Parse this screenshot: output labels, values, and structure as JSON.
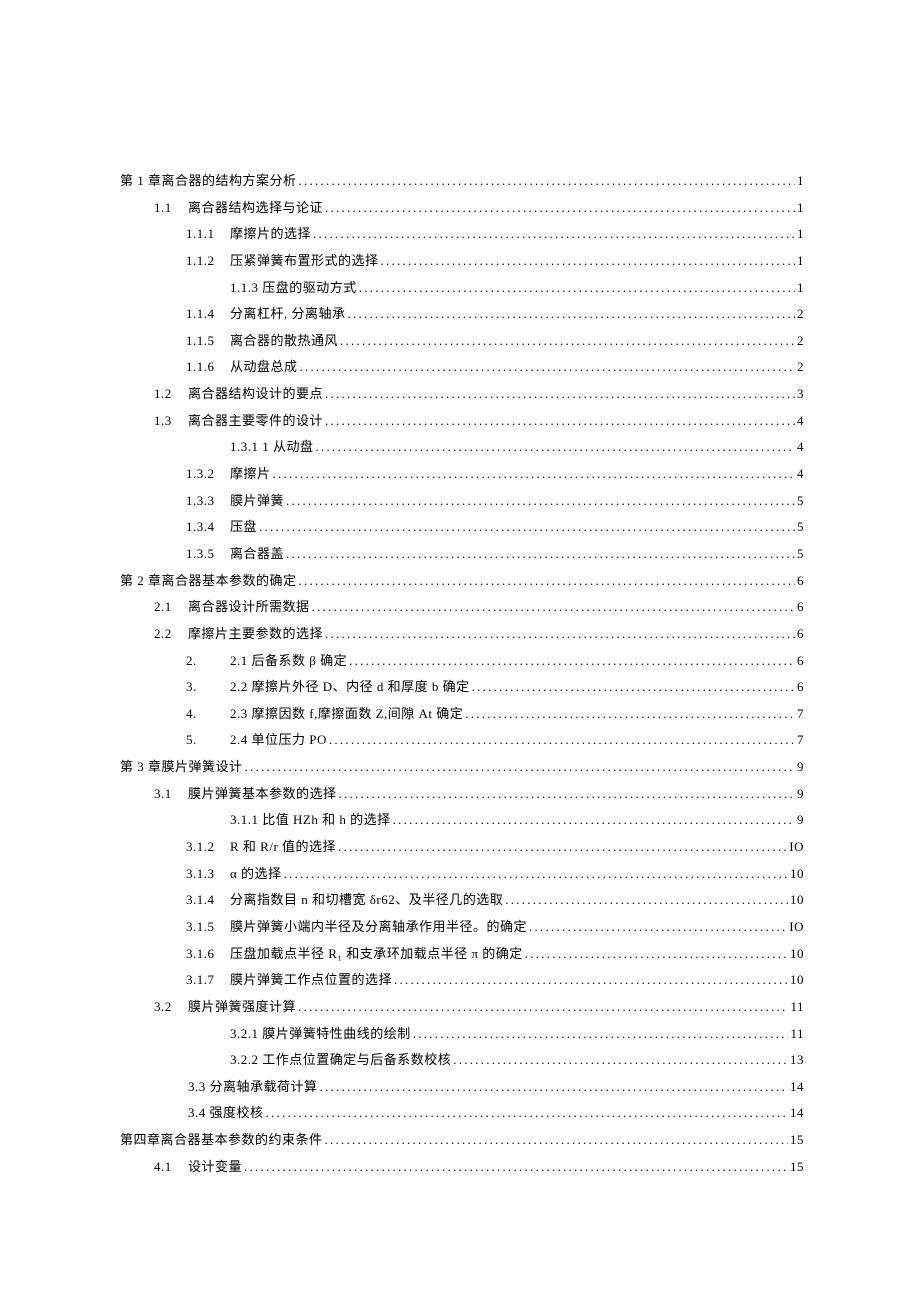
{
  "toc": [
    {
      "level": 0,
      "num": "",
      "title": "第 1 章离合器的结构方案分析",
      "page": "1"
    },
    {
      "level": 1,
      "num": "1.1",
      "title": "离合器结构选择与论证",
      "page": "1"
    },
    {
      "level": 2,
      "num": "1.1.1",
      "title": "摩擦片的选择",
      "page": "1"
    },
    {
      "level": 2,
      "num": "1.1.2",
      "title": "压紧弹簧布置形式的选择",
      "page": "1"
    },
    {
      "level": 2,
      "num": "",
      "title": "1.1.3 压盘的驱动方式",
      "page": "1"
    },
    {
      "level": 2,
      "num": "1.1.4",
      "title": "分离杠杆, 分离轴承",
      "page": "2"
    },
    {
      "level": 2,
      "num": "1.1.5",
      "title": "离合器的散热通风",
      "page": "2"
    },
    {
      "level": 2,
      "num": "1.1.6",
      "title": "从动盘总成",
      "page": "2"
    },
    {
      "level": 1,
      "num": "1.2",
      "title": "离合器结构设计的要点",
      "page": "3"
    },
    {
      "level": 1,
      "num": "1.3",
      "title": "离合器主要零件的设计",
      "page": "4"
    },
    {
      "level": 2,
      "num": "",
      "title": "1.3.1  1 从动盘",
      "page": "4"
    },
    {
      "level": 2,
      "num": "1.3.2",
      "title": "摩擦片",
      "page": "4"
    },
    {
      "level": 2,
      "num": "1.3.3",
      "title": "膜片弹簧",
      "page": "5"
    },
    {
      "level": 2,
      "num": "1.3.4",
      "title": "压盘",
      "page": "5"
    },
    {
      "level": 2,
      "num": "1.3.5",
      "title": "离合器盖",
      "page": "5"
    },
    {
      "level": 0,
      "num": "",
      "title": "第 2 章离合器基本参数的确定",
      "page": "6"
    },
    {
      "level": 1,
      "num": "2.1",
      "title": "离合器设计所需数据",
      "page": "6"
    },
    {
      "level": 1,
      "num": "2.2",
      "title": "摩擦片主要参数的选择",
      "page": "6"
    },
    {
      "level": 2,
      "num": "2.",
      "title": "2.1 后备系数 β 确定",
      "page": "6"
    },
    {
      "level": 2,
      "num": "3.",
      "title": "2.2 摩擦片外径 D、内径 d 和厚度 b 确定",
      "page": "6"
    },
    {
      "level": 2,
      "num": "4.",
      "title": "2.3 摩擦因数 f,摩擦面数 Z,间隙 At 确定",
      "page": "7"
    },
    {
      "level": 2,
      "num": "5.",
      "title": "2.4 单位压力 PO ",
      "page": "7"
    },
    {
      "level": 0,
      "num": "",
      "title": "第 3 章膜片弹簧设计",
      "page": "9"
    },
    {
      "level": 1,
      "num": "3.1",
      "title": "膜片弹簧基本参数的选择",
      "page": "9"
    },
    {
      "level": 2,
      "num": "",
      "title": "3.1.1  比值 HZh 和 h 的选择",
      "page": "9"
    },
    {
      "level": 2,
      "num": "3.1.2",
      "title": "R 和 R/r 值的选择",
      "page": "IO"
    },
    {
      "level": 2,
      "num": "3.1.3",
      "title": "α 的选择",
      "page": "10"
    },
    {
      "level": 2,
      "num": "3.1.4",
      "title": "分离指数目 n 和切槽宽 δr62、及半径几的选取",
      "page": "10"
    },
    {
      "level": 2,
      "num": "3.1.5",
      "title": "膜片弹簧小端内半径及分离轴承作用半径。的确定",
      "page": "IO"
    },
    {
      "level": 2,
      "num": "3.1.6",
      "title": "压盘加载点半径 R₁ 和支承环加载点半径 π 的确定",
      "page": "10"
    },
    {
      "level": 2,
      "num": "3.1.7",
      "title": "膜片弹簧工作点位置的选择",
      "page": "10"
    },
    {
      "level": 1,
      "num": "3.2",
      "title": "膜片弹簧强度计算",
      "page": "11"
    },
    {
      "level": 2,
      "num": "",
      "title": "3.2.1 膜片弹簧特性曲线的绘制",
      "page": "11"
    },
    {
      "level": 2,
      "num": "",
      "title": "3.2.2 工作点位置确定与后备系数校核",
      "page": "13"
    },
    {
      "level": 1,
      "num": "",
      "title": "3.3 分离轴承载荷计算",
      "page": "14"
    },
    {
      "level": 1,
      "num": "",
      "title": "3.4 强度校核",
      "page": "14"
    },
    {
      "level": 0,
      "num": "",
      "title": "第四章离合器基本参数的约束条件",
      "page": "15"
    },
    {
      "level": 1,
      "num": "4.1",
      "title": "设计变量",
      "page": "15"
    }
  ]
}
